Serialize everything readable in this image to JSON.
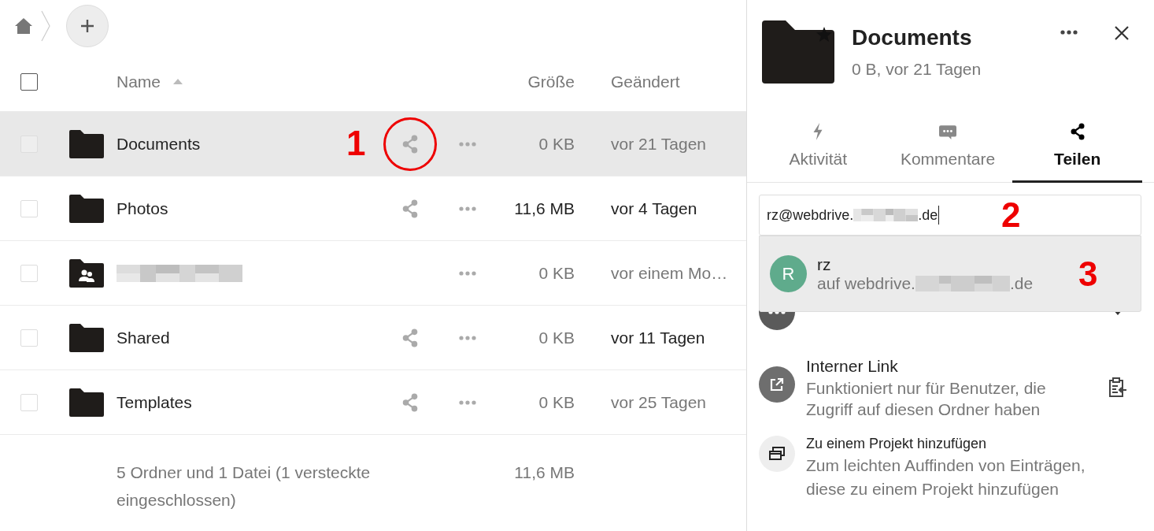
{
  "table": {
    "select_all_checked": false,
    "columns": [
      {
        "label": "Name",
        "sorted": true
      },
      {
        "label": "Größe"
      },
      {
        "label": "Geändert"
      }
    ],
    "rows": [
      {
        "kind": "folder",
        "name": "Documents",
        "redacted": false,
        "shared": true,
        "size": "0 KB",
        "modified": "vor 21 Tagen",
        "size_strong": false,
        "modified_strong": false,
        "selected": true,
        "checked": false,
        "marker": "1"
      },
      {
        "kind": "folder",
        "name": "Photos",
        "redacted": false,
        "shared": true,
        "size": "11,6 MB",
        "modified": "vor 4 Tagen",
        "size_strong": true,
        "modified_strong": true,
        "selected": false,
        "checked": false
      },
      {
        "kind": "group_folder",
        "redacted": true,
        "shared": false,
        "size": "0 KB",
        "modified": "vor einem Mo…",
        "size_strong": false,
        "modified_strong": false,
        "selected": false,
        "checked": false
      },
      {
        "kind": "folder",
        "name": "Shared",
        "redacted": false,
        "shared": true,
        "size": "0 KB",
        "modified": "vor 11 Tagen",
        "size_strong": false,
        "modified_strong": true,
        "selected": false,
        "checked": false
      },
      {
        "kind": "folder",
        "name": "Templates",
        "redacted": false,
        "shared": true,
        "size": "0 KB",
        "modified": "vor 25 Tagen",
        "size_strong": false,
        "modified_strong": false,
        "selected": false,
        "checked": false
      }
    ],
    "summary": {
      "text": "5 Ordner und 1 Datei (1 versteckte eingeschlossen)",
      "size": "11,6 MB"
    }
  },
  "sidebar": {
    "title": "Documents",
    "subtitle": "0 B, vor 21 Tagen",
    "favorite": true,
    "tabs": [
      {
        "label": "Aktivität",
        "selected": false
      },
      {
        "label": "Kommentare",
        "selected": false
      },
      {
        "label": "Teilen",
        "selected": true
      }
    ],
    "share_field": {
      "value_start": "rz@webdrive.",
      "value_end": ".de",
      "redacted": true,
      "marker": "2"
    },
    "suggestions": [
      {
        "initial": "R",
        "name": "rz",
        "detail_start": "auf webdrive.",
        "detail_end": ".de",
        "redacted": true,
        "marker": "3"
      }
    ],
    "sections": [
      {
        "kind": "others"
      },
      {
        "kind": "internal_link",
        "title": "Interner Link",
        "description": "Funktioniert nur für Benutzer, die Zugriff auf diesen Ordner haben"
      },
      {
        "kind": "project",
        "title": "Zu einem Projekt hinzufügen",
        "description": "Zum leichten Auffinden von Einträgen, diese zu einem Projekt hinzufügen"
      }
    ]
  }
}
